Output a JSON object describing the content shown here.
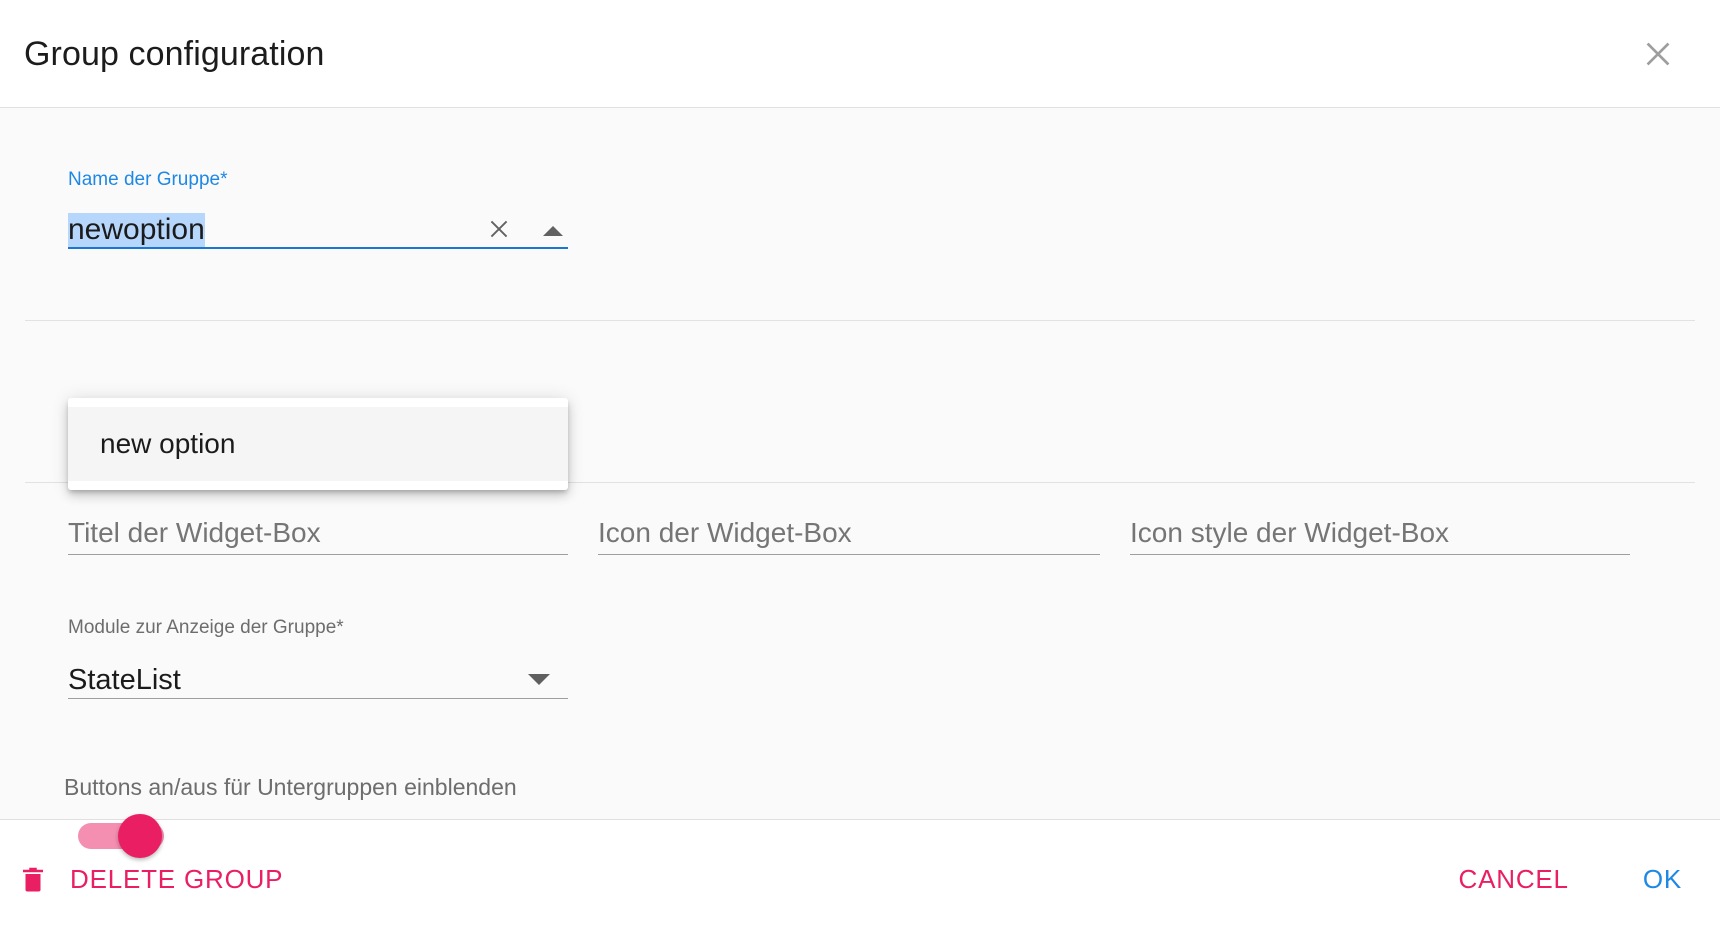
{
  "dialog": {
    "title": "Group configuration",
    "close_icon": "close-icon"
  },
  "form": {
    "group_name": {
      "label": "Name der Gruppe",
      "required_marker": "*",
      "value": "newoption",
      "clear_icon": "close-icon",
      "toggle_icon": "caret-up-icon"
    },
    "dropdown": {
      "options": [
        {
          "label": "new option"
        }
      ]
    },
    "widget_title": {
      "placeholder": "Titel der Widget-Box",
      "value": ""
    },
    "widget_icon": {
      "placeholder": "Icon der Widget-Box",
      "value": ""
    },
    "widget_icon_style": {
      "placeholder": "Icon style der Widget-Box",
      "value": ""
    },
    "module_select": {
      "label": "Module zur Anzeige der Gruppe",
      "required_marker": "*",
      "value": "StateList",
      "caret_icon": "caret-down-icon"
    },
    "subgroup_toggle": {
      "label": "Buttons an/aus für Untergruppen einblenden",
      "state": "on"
    }
  },
  "footer": {
    "delete_label": "DELETE GROUP",
    "delete_icon": "trash-icon",
    "cancel_label": "CANCEL",
    "ok_label": "OK"
  },
  "colors": {
    "accent_pink": "#e91e63",
    "accent_blue": "#1e88e5",
    "focus_underline": "#1976d2",
    "selection_highlight": "#b6d7fb",
    "body_background": "#fafafa",
    "divider": "#e2e2e2"
  }
}
